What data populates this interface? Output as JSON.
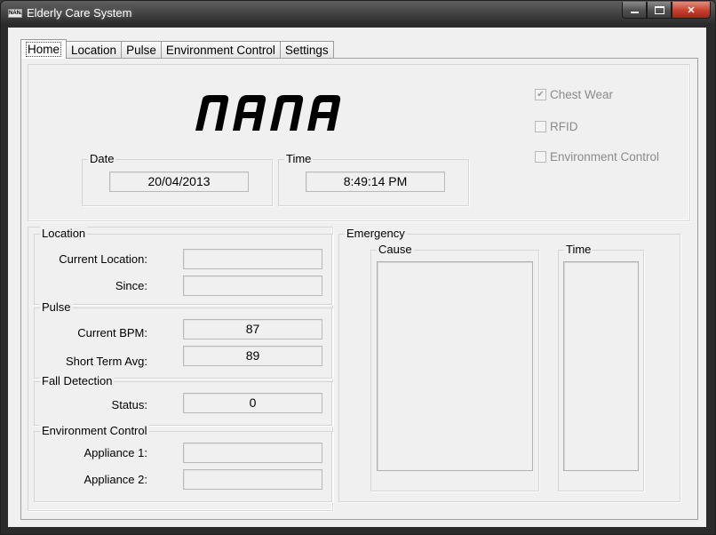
{
  "window": {
    "title": "Elderly Care System",
    "app_icon_text": "NANA"
  },
  "tabs": [
    "Home",
    "Location",
    "Pulse",
    "Environment Control",
    "Settings"
  ],
  "header": {
    "logo_text": "NANA",
    "date": {
      "label": "Date",
      "value": "20/04/2013"
    },
    "time": {
      "label": "Time",
      "value": "8:49:14 PM"
    },
    "checkboxes": [
      {
        "label": "Chest Wear",
        "checked": true
      },
      {
        "label": "RFID",
        "checked": false
      },
      {
        "label": "Environment Control",
        "checked": false
      }
    ]
  },
  "location": {
    "title": "Location",
    "current_label": "Current Location:",
    "current_value": "",
    "since_label": "Since:",
    "since_value": ""
  },
  "pulse": {
    "title": "Pulse",
    "bpm_label": "Current BPM:",
    "bpm_value": "87",
    "avg_label": "Short Term Avg:",
    "avg_value": "89"
  },
  "fall": {
    "title": "Fall Detection",
    "status_label": "Status:",
    "status_value": "0"
  },
  "environment": {
    "title": "Environment Control",
    "a1_label": "Appliance 1:",
    "a1_value": "",
    "a2_label": "Appliance 2:",
    "a2_value": ""
  },
  "emergency": {
    "title": "Emergency",
    "cause_label": "Cause",
    "time_label": "Time"
  },
  "colors": {
    "close_button": "#c7402c",
    "titlebar": "#2b2b2b",
    "client": "#f0f0f0"
  }
}
